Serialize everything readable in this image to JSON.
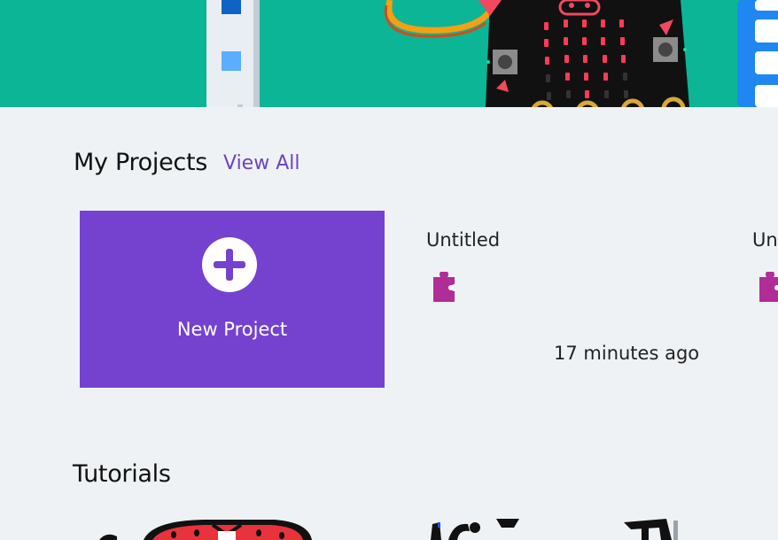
{
  "colors": {
    "hero_bg": "#0bb596",
    "page_bg": "#eff2f4",
    "accent": "#7442cf",
    "link": "#6f42c1",
    "blocks_icon": "#b02d98"
  },
  "my_projects": {
    "title": "My Projects",
    "view_all_label": "View All"
  },
  "new_project": {
    "label": "New Project",
    "icon": "plus-circle-icon"
  },
  "projects": [
    {
      "title": "Untitled",
      "icon": "puzzle-piece-icon",
      "time": "17 minutes ago"
    },
    {
      "title": "Untitled",
      "icon": "puzzle-piece-icon",
      "time": ""
    }
  ],
  "tutorials": {
    "title": "Tutorials"
  }
}
